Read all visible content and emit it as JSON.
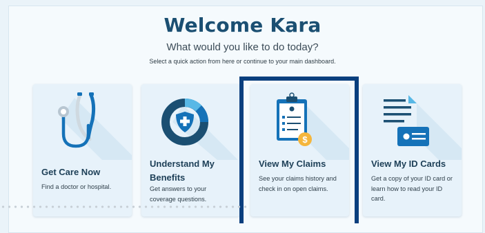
{
  "header": {
    "title": "Welcome Kara",
    "subtitle": "What would you like to do today?",
    "helper": "Select a quick action from here or continue to your main dashboard."
  },
  "cards": [
    {
      "title": "Get Care Now",
      "desc": "Find a doctor or hospital.",
      "icon": "stethoscope-icon"
    },
    {
      "title": "Understand My Benefits",
      "desc": "Get answers to your coverage questions.",
      "icon": "shield-donut-icon"
    },
    {
      "title": "View My Claims",
      "desc": "See your claims history and check in on open claims.",
      "icon": "clipboard-icon",
      "selected": true
    },
    {
      "title": "View My ID Cards",
      "desc": "Get a copy of your ID card or learn how to read your ID card.",
      "icon": "id-card-icon"
    }
  ],
  "colors": {
    "title": "#1b4f72",
    "accent_blue": "#1572b8",
    "light_blue": "#58b8e6",
    "highlight": "#0b3f7e",
    "coin": "#f5b63c"
  }
}
